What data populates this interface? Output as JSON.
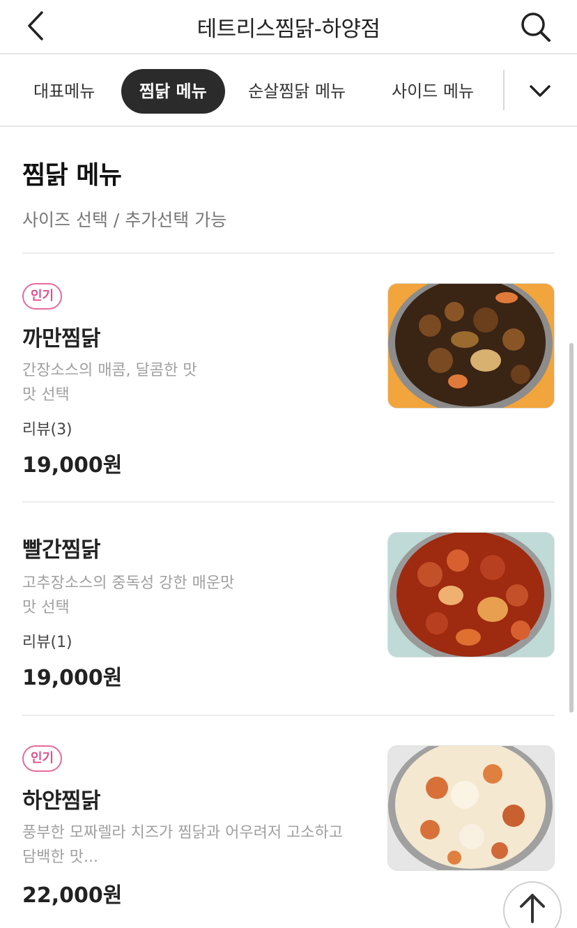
{
  "header": {
    "title": "테트리스찜닭-하양점",
    "back_icon": "chevron-left-icon",
    "search_icon": "search-icon"
  },
  "tabs": [
    {
      "label": "대표메뉴",
      "active": false
    },
    {
      "label": "찜닭 메뉴",
      "active": true
    },
    {
      "label": "순살찜닭 메뉴",
      "active": false
    },
    {
      "label": "사이드 메뉴",
      "active": false
    }
  ],
  "tabs_more_icon": "chevron-down-icon",
  "section": {
    "title": "찜닭 메뉴",
    "subtitle": "사이즈 선택 / 추가선택 가능"
  },
  "items": [
    {
      "badge": "인기",
      "name": "까만찜닭",
      "desc": [
        "간장소스의 매콤, 달콤한 맛",
        "맛 선택"
      ],
      "review": "리뷰(3)",
      "price": "19,000원"
    },
    {
      "badge": "",
      "name": "빨간찜닭",
      "desc": [
        "고추장소스의 중독성 강한 매운맛",
        "맛 선택"
      ],
      "review": "리뷰(1)",
      "price": "19,000원"
    },
    {
      "badge": "인기",
      "name": "하얀찜닭",
      "desc": [
        "풍부한 모짜렐라 치즈가 찜닭과 어우려저 고소하고",
        "담백한 맛..."
      ],
      "review": "",
      "price": "22,000원"
    }
  ],
  "colors": {
    "badge": "#e0508a",
    "active_tab_bg": "#2b2b2b"
  },
  "scroll_top_icon": "arrow-up-icon"
}
